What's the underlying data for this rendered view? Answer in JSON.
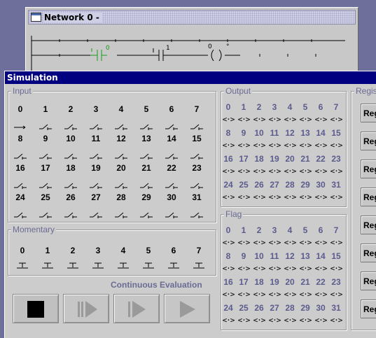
{
  "network_window": {
    "title": "Network 0 -",
    "contacts": [
      {
        "label": "0",
        "color": "#1a9a1a"
      },
      {
        "label": "1",
        "color": "#000000"
      }
    ],
    "coil": {
      "label": "0"
    }
  },
  "simulation": {
    "title": "Simulation",
    "input": {
      "label": "Input",
      "rows": [
        [
          "0",
          "1",
          "2",
          "3",
          "4",
          "5",
          "6",
          "7"
        ],
        [
          "8",
          "9",
          "10",
          "11",
          "12",
          "13",
          "14",
          "15"
        ],
        [
          "16",
          "17",
          "18",
          "19",
          "20",
          "21",
          "22",
          "23"
        ],
        [
          "24",
          "25",
          "26",
          "27",
          "28",
          "29",
          "30",
          "31"
        ]
      ],
      "first_switch_closed": true
    },
    "momentary": {
      "label": "Momentary",
      "items": [
        "0",
        "1",
        "2",
        "3",
        "4",
        "5",
        "6",
        "7"
      ]
    },
    "output": {
      "label": "Output",
      "rows": [
        [
          "0",
          "1",
          "2",
          "3",
          "4",
          "5",
          "6",
          "7"
        ],
        [
          "8",
          "9",
          "10",
          "11",
          "12",
          "13",
          "14",
          "15"
        ],
        [
          "16",
          "17",
          "18",
          "19",
          "20",
          "21",
          "22",
          "23"
        ],
        [
          "24",
          "25",
          "26",
          "27",
          "28",
          "29",
          "30",
          "31"
        ]
      ],
      "coil_glyph": "<·>"
    },
    "flag": {
      "label": "Flag",
      "rows": [
        [
          "0",
          "1",
          "2",
          "3",
          "4",
          "5",
          "6",
          "7"
        ],
        [
          "8",
          "9",
          "10",
          "11",
          "12",
          "13",
          "14",
          "15"
        ],
        [
          "16",
          "17",
          "18",
          "19",
          "20",
          "21",
          "22",
          "23"
        ],
        [
          "24",
          "25",
          "26",
          "27",
          "28",
          "29",
          "30",
          "31"
        ]
      ],
      "coil_glyph": "<·>"
    },
    "registers": {
      "label": "Regis",
      "buttons": [
        "Reg",
        "Reg",
        "Reg",
        "Reg",
        "Reg",
        "Reg",
        "Reg",
        "Reg"
      ]
    },
    "evaluation_mode": "Continuous Evaluation",
    "controls": [
      {
        "name": "stop",
        "icon": "stop-icon",
        "active": true
      },
      {
        "name": "step",
        "icon": "step-icon",
        "active": false
      },
      {
        "name": "run-once",
        "icon": "run-once-icon",
        "active": false
      },
      {
        "name": "run",
        "icon": "play-icon",
        "active": false
      }
    ]
  }
}
